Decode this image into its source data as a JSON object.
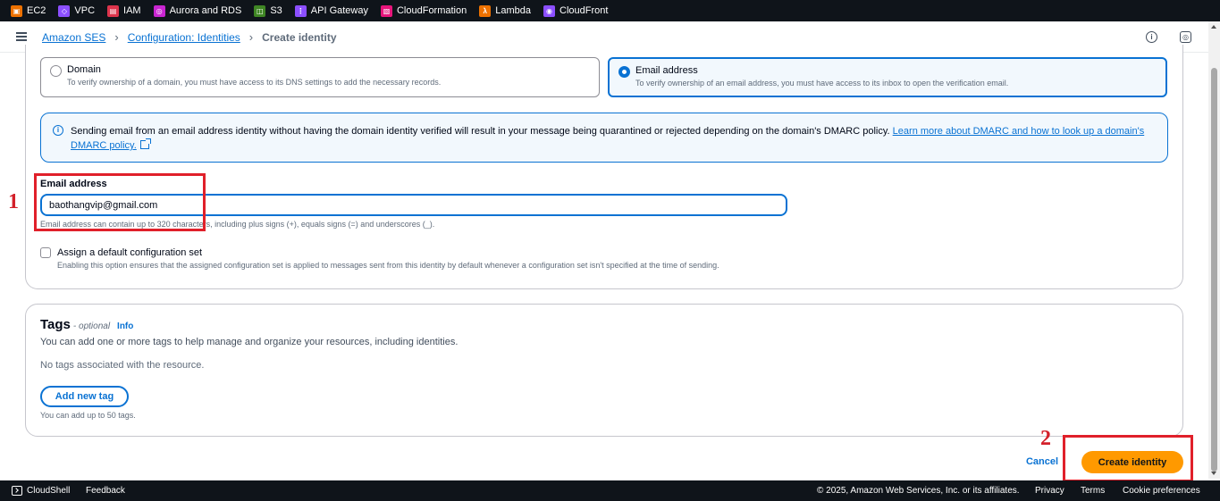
{
  "favorites": [
    {
      "label": "EC2",
      "icon": "ec2-icon",
      "color": "#ed7100"
    },
    {
      "label": "VPC",
      "icon": "vpc-icon",
      "color": "#8c4fff"
    },
    {
      "label": "IAM",
      "icon": "iam-icon",
      "color": "#dd344c"
    },
    {
      "label": "Aurora and RDS",
      "icon": "rds-icon",
      "color": "#c925d1"
    },
    {
      "label": "S3",
      "icon": "s3-icon",
      "color": "#3f8624"
    },
    {
      "label": "API Gateway",
      "icon": "api-gateway-icon",
      "color": "#8c4fff"
    },
    {
      "label": "CloudFormation",
      "icon": "cloudformation-icon",
      "color": "#e7157b"
    },
    {
      "label": "Lambda",
      "icon": "lambda-icon",
      "color": "#ed7100"
    },
    {
      "label": "CloudFront",
      "icon": "cloudfront-icon",
      "color": "#8c4fff"
    }
  ],
  "breadcrumb": {
    "items": [
      "Amazon SES",
      "Configuration: Identities"
    ],
    "current": "Create identity"
  },
  "identity_type": {
    "domain": {
      "title": "Domain",
      "description": "To verify ownership of a domain, you must have access to its DNS settings to add the necessary records.",
      "selected": false
    },
    "email": {
      "title": "Email address",
      "description": "To verify ownership of an email address, you must have access to its inbox to open the verification email.",
      "selected": true
    }
  },
  "info_alert": {
    "text": "Sending email from an email address identity without having the domain identity verified will result in your message being quarantined or rejected depending on the domain's DMARC policy. ",
    "link": "Learn more about DMARC and how to look up a domain's DMARC policy."
  },
  "email_field": {
    "label": "Email address",
    "value": "baothangvip@gmail.com",
    "hint": "Email address can contain up to 320 characters, including plus signs (+), equals signs (=) and underscores (_)."
  },
  "default_config": {
    "label": "Assign a default configuration set",
    "description": "Enabling this option ensures that the assigned configuration set is applied to messages sent from this identity by default whenever a configuration set isn't specified at the time of sending.",
    "checked": false
  },
  "tags": {
    "title": "Tags",
    "optional": "- optional",
    "info": "Info",
    "description": "You can add one or more tags to help manage and organize your resources, including identities.",
    "empty": "No tags associated with the resource.",
    "add_button": "Add new tag",
    "limit": "You can add up to 50 tags."
  },
  "actions": {
    "cancel": "Cancel",
    "create": "Create identity"
  },
  "annotations": [
    "1",
    "2"
  ],
  "footer": {
    "cloudshell": "CloudShell",
    "feedback": "Feedback",
    "copyright": "© 2025, Amazon Web Services, Inc. or its affiliates.",
    "privacy": "Privacy",
    "terms": "Terms",
    "cookies": "Cookie preferences"
  }
}
